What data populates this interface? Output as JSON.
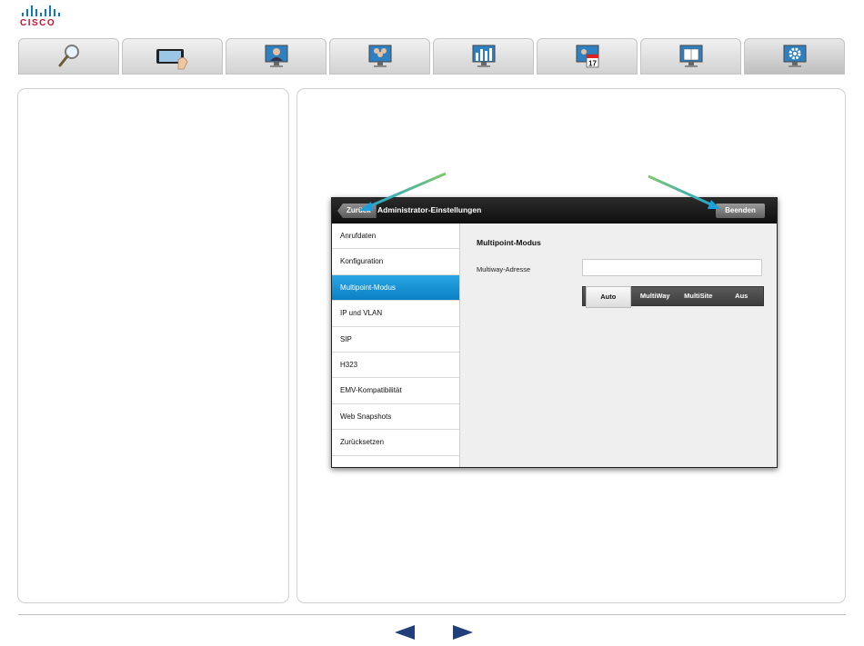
{
  "brand": {
    "logo_text": "CISCO",
    "logo_color": "#c8102e",
    "bars_color": "#0b7bbf"
  },
  "tabs": [
    {
      "id": "search",
      "icon": "magnifier-icon"
    },
    {
      "id": "touch",
      "icon": "touch-panel-icon"
    },
    {
      "id": "call",
      "icon": "person-screen-icon"
    },
    {
      "id": "multi",
      "icon": "group-screen-icon"
    },
    {
      "id": "presentation",
      "icon": "chart-screen-icon"
    },
    {
      "id": "calendar",
      "icon": "calendar-screen-icon",
      "calendar_day": "17"
    },
    {
      "id": "book",
      "icon": "book-screen-icon"
    },
    {
      "id": "settings",
      "icon": "gear-screen-icon",
      "active": true
    }
  ],
  "device": {
    "back_label": "Zurück",
    "title": "Administrator-Einstellungen",
    "end_label": "Beenden",
    "menu": [
      "Anrufdaten",
      "Konfiguration",
      "Multipoint-Modus",
      "IP und VLAN",
      "SIP",
      "H323",
      "EMV-Kompatibilität",
      "Web Snapshots",
      "Zurücksetzen"
    ],
    "selected_menu": "Multipoint-Modus",
    "content": {
      "title": "Multipoint-Modus",
      "address_label": "Multiway-Adresse",
      "address_value": "",
      "modes": [
        "Auto",
        "MultiWay",
        "MultiSite",
        "Aus"
      ],
      "selected_mode": "Auto"
    }
  },
  "footer": {
    "prev_icon": "triangle-left-icon",
    "next_icon": "triangle-right-icon",
    "nav_color": "#1f3f7a"
  },
  "colors": {
    "accent": "#0a80c4",
    "arrow_green": "#7ec86a",
    "arrow_blue": "#1aa0dc"
  }
}
